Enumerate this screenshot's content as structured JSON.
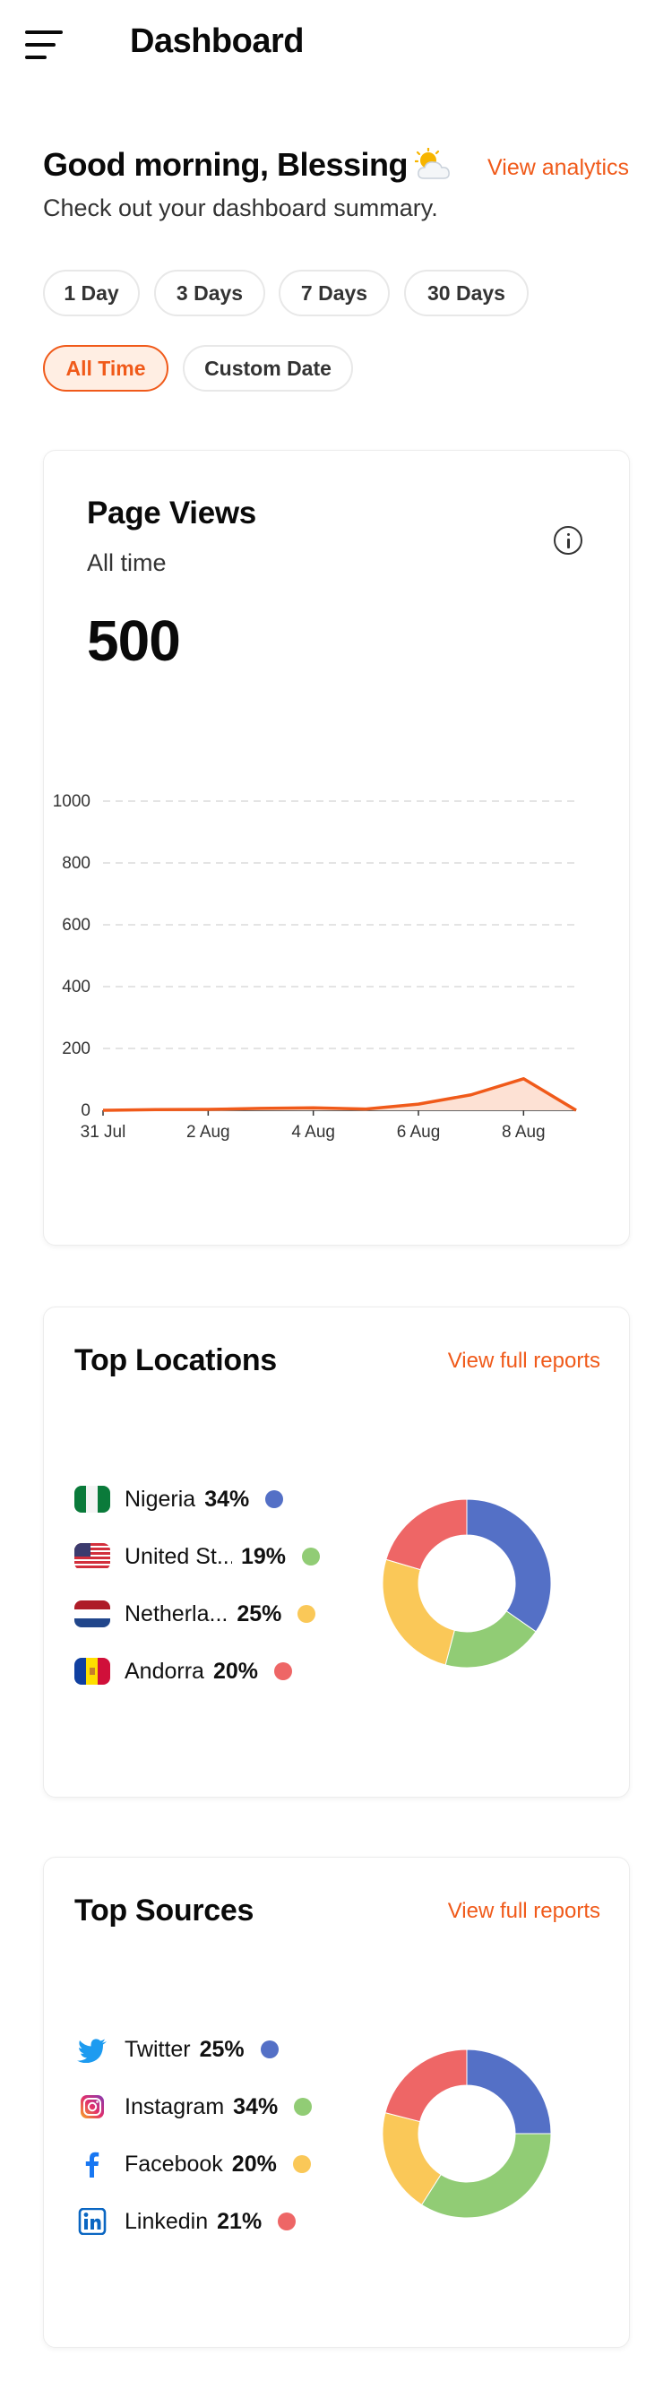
{
  "header": {
    "title": "Dashboard"
  },
  "greeting": {
    "text": "Good morning, Blessing",
    "weather_icon": "sun-behind-cloud-icon",
    "subtitle": "Check out your dashboard summary.",
    "link": "View analytics"
  },
  "filters": {
    "options": [
      "1 Day",
      "3 Days",
      "7 Days",
      "30 Days",
      "All Time",
      "Custom Date"
    ],
    "selected": "All Time"
  },
  "page_views": {
    "title": "Page Views",
    "period": "All time",
    "value": "500"
  },
  "colors": {
    "accent": "#f05a1a",
    "blue": "#5470c6",
    "green": "#91cc75",
    "yellow": "#fac858",
    "red": "#ee6666"
  },
  "chart_data": [
    {
      "type": "area",
      "x": [
        "31 Jul",
        "1 Aug",
        "2 Aug",
        "3 Aug",
        "4 Aug",
        "5 Aug",
        "6 Aug",
        "7 Aug",
        "8 Aug",
        "9 Aug"
      ],
      "xticks": [
        "31 Jul",
        "2 Aug",
        "4 Aug",
        "6 Aug",
        "8 Aug"
      ],
      "values": [
        0,
        2,
        3,
        6,
        8,
        4,
        20,
        50,
        102,
        0
      ],
      "ylim": [
        0,
        1000
      ],
      "yticks": [
        0,
        200,
        400,
        600,
        800,
        1000
      ],
      "grid": true
    },
    {
      "type": "pie",
      "title": "Top Locations",
      "categories": [
        "Nigeria",
        "United St...",
        "Netherla...",
        "Andorra"
      ],
      "values": [
        34,
        19,
        25,
        20
      ]
    },
    {
      "type": "pie",
      "title": "Top Sources",
      "categories": [
        "Twitter",
        "Instagram",
        "Facebook",
        "Linkedin"
      ],
      "values": [
        25,
        34,
        20,
        21
      ]
    }
  ],
  "top_locations": {
    "title": "Top Locations",
    "link": "View full reports",
    "items": [
      {
        "name": "Nigeria",
        "pct": "34%",
        "icon": "nigeria-flag-icon"
      },
      {
        "name": "United St...",
        "pct": "19%",
        "icon": "usa-flag-icon"
      },
      {
        "name": "Netherla...",
        "pct": "25%",
        "icon": "netherlands-flag-icon"
      },
      {
        "name": "Andorra",
        "pct": "20%",
        "icon": "andorra-flag-icon"
      }
    ]
  },
  "top_sources": {
    "title": "Top Sources",
    "link": "View full reports",
    "items": [
      {
        "name": "Twitter",
        "pct": "25%",
        "icon": "twitter-icon"
      },
      {
        "name": "Instagram",
        "pct": "34%",
        "icon": "instagram-icon"
      },
      {
        "name": "Facebook",
        "pct": "20%",
        "icon": "facebook-icon"
      },
      {
        "name": "Linkedin",
        "pct": "21%",
        "icon": "linkedin-icon"
      }
    ]
  }
}
